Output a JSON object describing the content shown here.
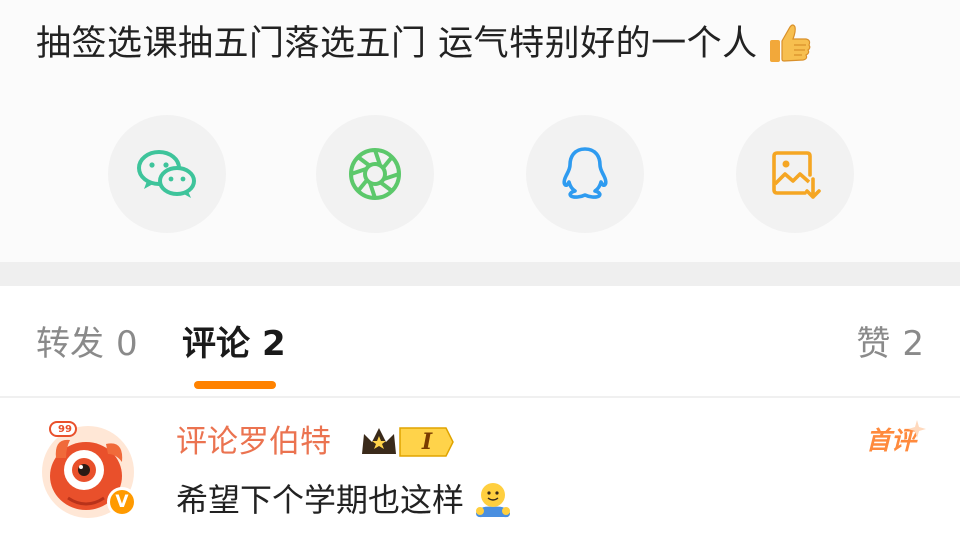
{
  "post": {
    "text": "抽签选课抽五门落选五门 运气特别好的一个人",
    "emoji": "thumbs-up-icon"
  },
  "share": {
    "buttons": [
      {
        "icon": "wechat-icon",
        "color": "#3ec49b"
      },
      {
        "icon": "moments-icon",
        "color": "#5cc86b"
      },
      {
        "icon": "qq-icon",
        "color": "#2e9bf0"
      },
      {
        "icon": "save-image-icon",
        "color": "#f5a623"
      }
    ]
  },
  "tabs": {
    "repost_label": "转发",
    "repost_count": "0",
    "comment_label": "评论",
    "comment_count": "2",
    "like_label": "赞",
    "like_count": "2",
    "active_color": "#ff8200"
  },
  "comment": {
    "username": "评论罗伯特",
    "level": "I",
    "avatar_badge": "99",
    "verified_mark": "V",
    "first_tag": "首评",
    "text": "希望下个学期也这样",
    "emoji": "hug-emoji-icon",
    "username_color": "#eb7350"
  }
}
